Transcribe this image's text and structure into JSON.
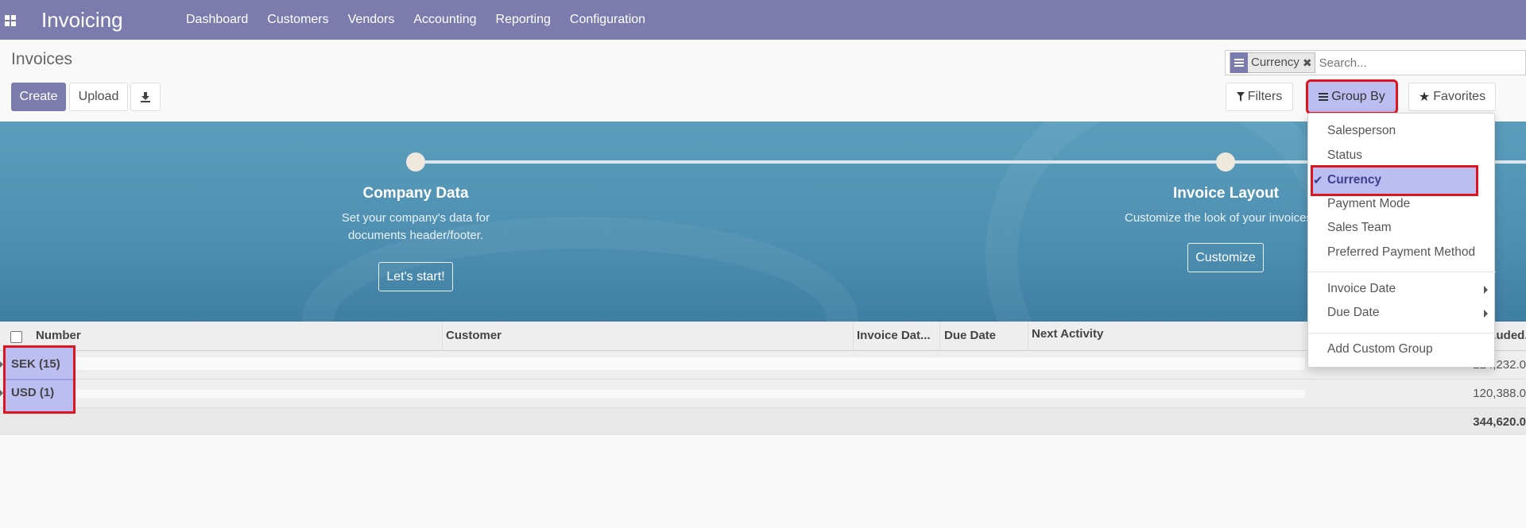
{
  "app": {
    "title": "Invoicing",
    "menu": [
      "Dashboard",
      "Customers",
      "Vendors",
      "Accounting",
      "Reporting",
      "Configuration"
    ]
  },
  "page": {
    "title": "Invoices",
    "create_label": "Create",
    "upload_label": "Upload",
    "filters_label": "Filters",
    "group_by_label": "Group By",
    "favorites_label": "Favorites"
  },
  "search": {
    "facet_label": "Currency",
    "placeholder": "Search..."
  },
  "banner": {
    "step1": {
      "title": "Company Data",
      "desc_line1": "Set your company's data for",
      "desc_line2": "documents header/footer.",
      "button": "Let's start!"
    },
    "step2": {
      "title": "Invoice Layout",
      "desc": "Customize the look of your invoices.",
      "button": "Customize"
    }
  },
  "table": {
    "headers": [
      "Number",
      "Customer",
      "Invoice Dat...",
      "Due Date",
      "Next Activity",
      "...uded."
    ],
    "groups": [
      {
        "label": "SEK (15)",
        "amount": "224,232.0"
      },
      {
        "label": "USD (1)",
        "amount": "120,388.0"
      }
    ],
    "total": "344,620.0"
  },
  "group_by_menu": {
    "items": [
      "Salesperson",
      "Status",
      "Currency",
      "Payment Mode",
      "Sales Team",
      "Preferred Payment Method"
    ],
    "date_items": [
      "Invoice Date",
      "Due Date"
    ],
    "custom": "Add Custom Group",
    "selected": "Currency"
  },
  "colors": {
    "navbar": "#7c7bad",
    "highlight": "#e0141e",
    "selection": "#bcbdf0"
  }
}
